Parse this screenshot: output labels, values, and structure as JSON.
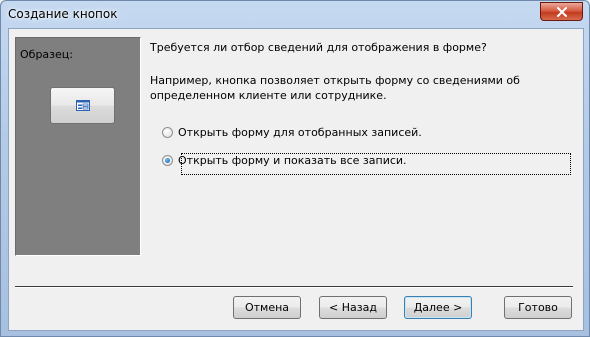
{
  "window": {
    "title": "Создание кнопок"
  },
  "sample": {
    "label": "Образец:",
    "button_icon": "form-icon"
  },
  "content": {
    "question": "Требуется ли отбор сведений для отображения в форме?",
    "example": "Например, кнопка позволяет открыть форму со сведениями об определенном клиенте или сотруднике.",
    "options": [
      {
        "label": "Открыть форму для отобранных записей.",
        "selected": false
      },
      {
        "label": "Открыть форму и показать все записи.",
        "selected": true
      }
    ]
  },
  "buttons": {
    "cancel": "Отмена",
    "back": "< Назад",
    "next": "Далее >",
    "finish": "Готово"
  },
  "colors": {
    "accent": "#3c7fb1",
    "sample_panel": "#7f7f7f",
    "close_button": "#c13a1d"
  }
}
